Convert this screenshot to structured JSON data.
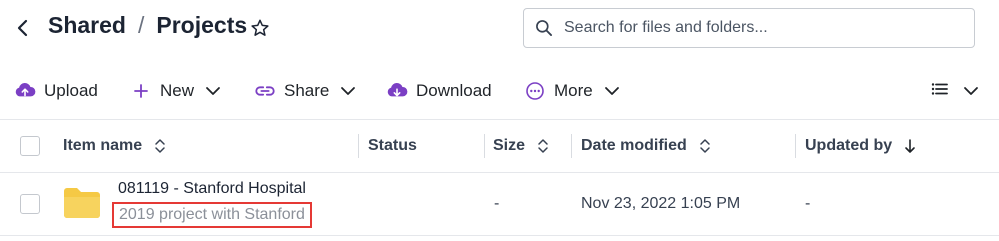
{
  "breadcrumb": {
    "parent": "Shared",
    "separator": "/",
    "current": "Projects"
  },
  "search": {
    "placeholder": "Search for files and folders..."
  },
  "toolbar": {
    "upload": "Upload",
    "new": "New",
    "share": "Share",
    "download": "Download",
    "more": "More"
  },
  "table": {
    "columns": {
      "name": "Item name",
      "status": "Status",
      "size": "Size",
      "date": "Date modified",
      "updated_by": "Updated by"
    },
    "rows": [
      {
        "name": "081119 - Stanford Hospital",
        "description": "2019 project with Stanford",
        "status": "",
        "size": "-",
        "date": "Nov 23, 2022 1:05 PM",
        "updated_by": "-"
      }
    ]
  },
  "colors": {
    "accent": "#7b3fc4",
    "folder": "#f5c945",
    "highlight_border": "#e53935"
  },
  "icons": {
    "back": "chevron-left-icon",
    "favorite": "star-icon",
    "search": "search-icon",
    "upload": "cloud-upload-icon",
    "new": "plus-icon",
    "share": "link-icon",
    "download": "cloud-download-icon",
    "more": "ellipsis-circle-icon",
    "view": "list-view-icon",
    "folder": "folder-icon"
  }
}
